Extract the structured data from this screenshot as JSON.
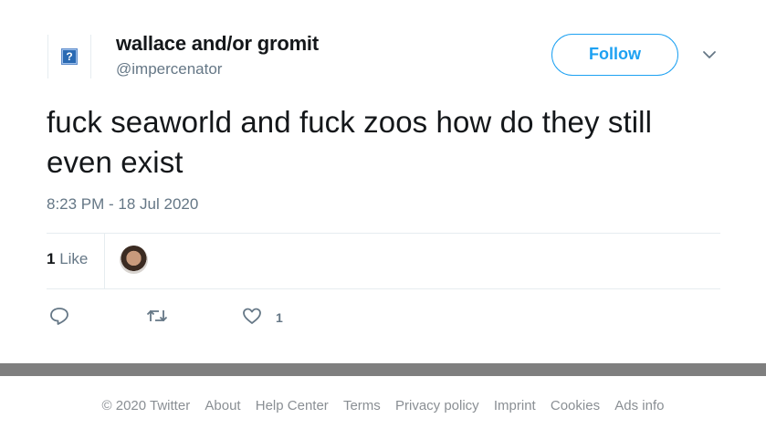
{
  "tweet": {
    "author": {
      "display_name": "wallace and/or gromit",
      "handle": "@impercenator",
      "avatar_icon": "broken-image-icon"
    },
    "follow_label": "Follow",
    "menu_icon": "chevron-down-icon",
    "text": "fuck seaworld and fuck zoos how do they still even exist",
    "timestamp": "8:23 PM - 18 Jul 2020",
    "likes": {
      "count": "1",
      "label": "Like"
    },
    "actions": {
      "reply_icon": "reply-icon",
      "retweet_icon": "retweet-icon",
      "like_icon": "heart-icon",
      "like_count": "1"
    },
    "colors": {
      "accent": "#1da1f2",
      "muted": "#657786",
      "text": "#14171a"
    }
  },
  "footer": {
    "links": [
      "© 2020 Twitter",
      "About",
      "Help Center",
      "Terms",
      "Privacy policy",
      "Imprint",
      "Cookies",
      "Ads info"
    ]
  }
}
